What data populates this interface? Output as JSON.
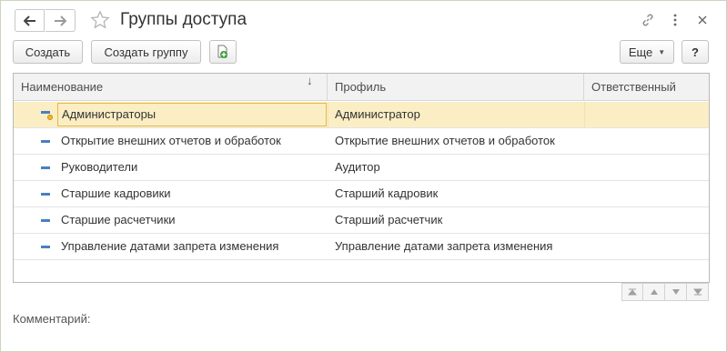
{
  "window": {
    "title": "Группы доступа"
  },
  "header": {
    "back_icon": "arrow-left-icon",
    "forward_icon": "arrow-right-icon",
    "favorite_icon": "star-icon",
    "link_icon": "link-icon",
    "more_icon": "more-vertical-icon",
    "close_icon": "close-icon"
  },
  "toolbar": {
    "create_label": "Создать",
    "create_group_label": "Создать группу",
    "copy_icon": "copy-add-icon",
    "more_label": "Еще",
    "help_label": "?"
  },
  "table": {
    "columns": {
      "name": "Наименование",
      "profile": "Профиль",
      "responsible": "Ответственный"
    },
    "sort_indicator": "↓",
    "rows": [
      {
        "name": "Администраторы",
        "profile": "Администратор",
        "responsible": "",
        "selected": true
      },
      {
        "name": "Открытие внешних отчетов и обработок",
        "profile": "Открытие внешних отчетов и обработок",
        "responsible": ""
      },
      {
        "name": "Руководители",
        "profile": "Аудитор",
        "responsible": ""
      },
      {
        "name": "Старшие кадровики",
        "profile": "Старший кадровик",
        "responsible": ""
      },
      {
        "name": "Старшие расчетчики",
        "profile": "Старший расчетчик",
        "responsible": ""
      },
      {
        "name": "Управление датами запрета изменения",
        "profile": "Управление датами запрета изменения",
        "responsible": ""
      }
    ]
  },
  "footer": {
    "comment_label": "Комментарий:"
  },
  "colors": {
    "selected_row": "#fbeec4",
    "selected_border": "#e8b93f",
    "group_icon": "#4a7fc1",
    "copy_icon_green": "#3b9b3b"
  }
}
